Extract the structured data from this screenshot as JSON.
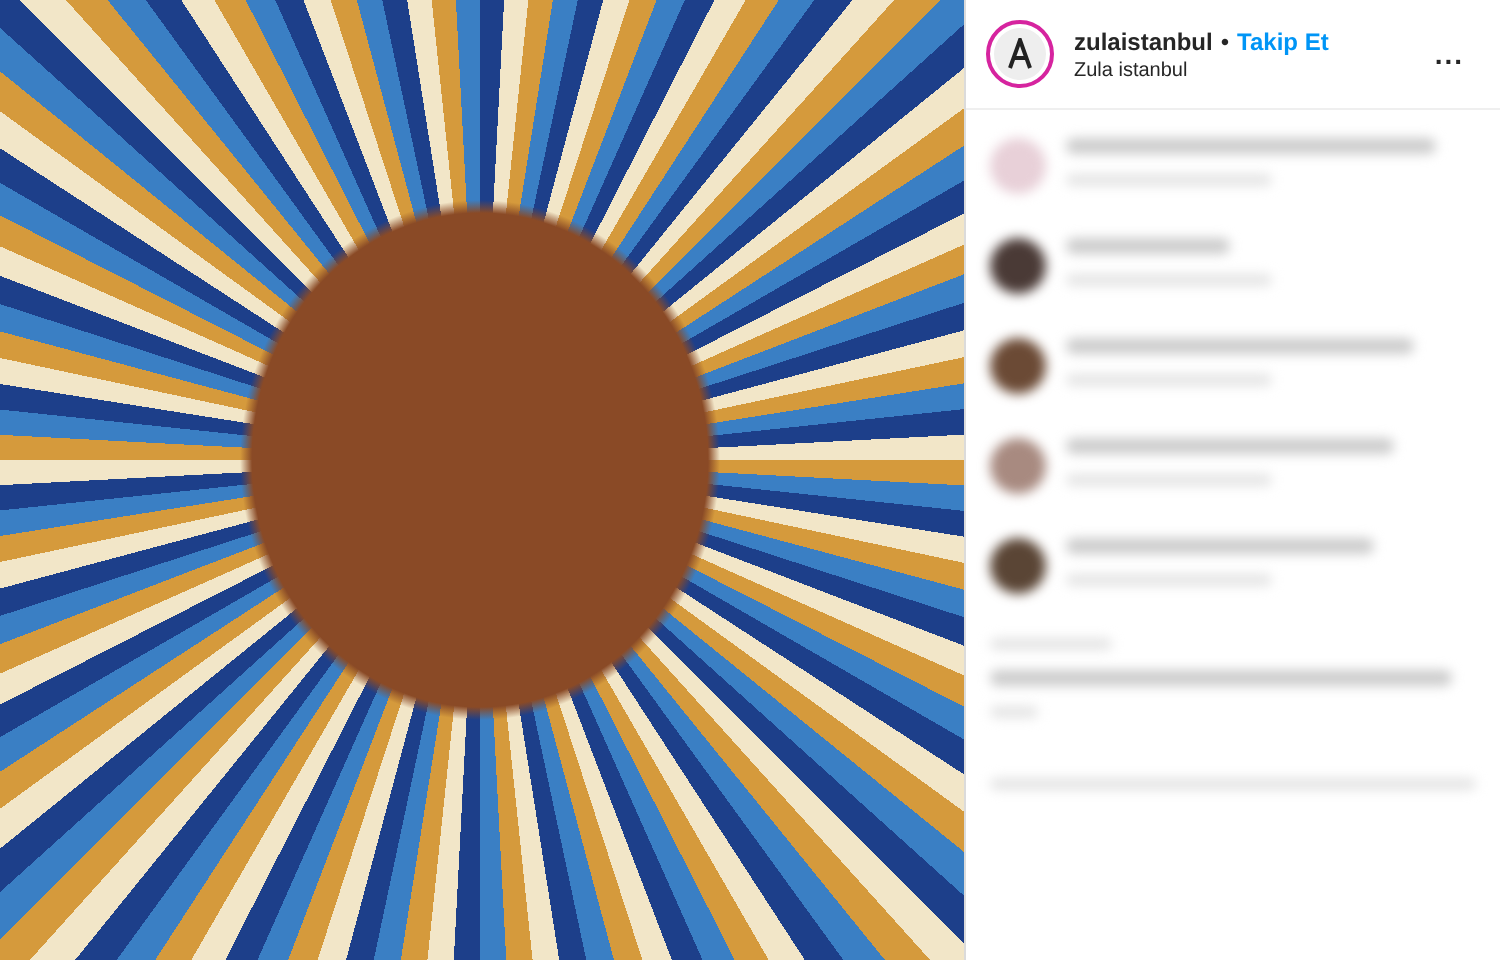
{
  "post": {
    "username": "zulaistanbul",
    "separator": "•",
    "follow_button": "Takip Et",
    "location": "Zula istanbul",
    "menu": "..."
  }
}
